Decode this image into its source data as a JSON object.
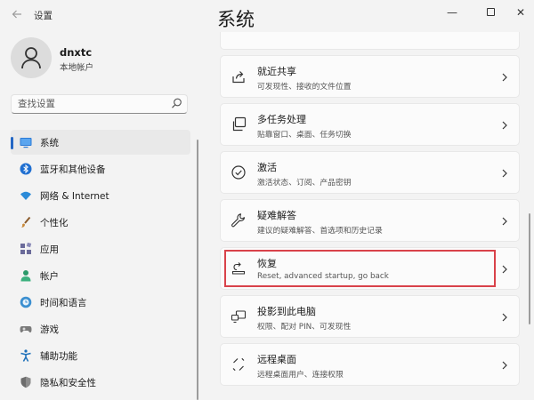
{
  "window": {
    "app_title": "设置",
    "back_icon": "arrow-left-icon",
    "controls": {
      "minimize": "—",
      "close": "✕"
    }
  },
  "account": {
    "name": "dnxtc",
    "type": "本地帐户"
  },
  "search": {
    "placeholder": "查找设置"
  },
  "nav": {
    "items": [
      {
        "label": "系统",
        "icon": "monitor-icon",
        "active": true
      },
      {
        "label": "蓝牙和其他设备",
        "icon": "bluetooth-icon"
      },
      {
        "label": "网络 & Internet",
        "icon": "wifi-icon"
      },
      {
        "label": "个性化",
        "icon": "brush-icon"
      },
      {
        "label": "应用",
        "icon": "apps-icon"
      },
      {
        "label": "帐户",
        "icon": "person-icon"
      },
      {
        "label": "时间和语言",
        "icon": "globe-clock-icon"
      },
      {
        "label": "游戏",
        "icon": "gamepad-icon"
      },
      {
        "label": "辅助功能",
        "icon": "accessibility-icon"
      },
      {
        "label": "隐私和安全性",
        "icon": "shield-icon"
      }
    ],
    "colors": {
      "accent": "#2467c4",
      "bluetooth": "#1f6fd1",
      "wifi": "#2b8bd8",
      "apps": "#6b6b9a",
      "person": "#2c9a6a",
      "globe": "#3b8fd0",
      "access": "#1b6fb9",
      "shield": "#6d6d6d"
    }
  },
  "main": {
    "title": "系统",
    "cards": [
      {
        "title": "就近共享",
        "subtitle": "可发现性、接收的文件位置",
        "icon": "nearby-share-icon"
      },
      {
        "title": "多任务处理",
        "subtitle": "贴靠窗口、桌面、任务切换",
        "icon": "multitask-icon"
      },
      {
        "title": "激活",
        "subtitle": "激活状态、订阅、产品密钥",
        "icon": "check-circle-icon"
      },
      {
        "title": "疑难解答",
        "subtitle": "建议的疑难解答、首选项和历史记录",
        "icon": "wrench-icon"
      },
      {
        "title": "恢复",
        "subtitle": "Reset, advanced startup, go back",
        "icon": "recovery-icon",
        "highlighted": true
      },
      {
        "title": "投影到此电脑",
        "subtitle": "权限、配对 PIN、可发现性",
        "icon": "projection-icon"
      },
      {
        "title": "远程桌面",
        "subtitle": "远程桌面用户、连接权限",
        "icon": "remote-desktop-icon"
      }
    ],
    "highlight_color": "#d9424a"
  }
}
